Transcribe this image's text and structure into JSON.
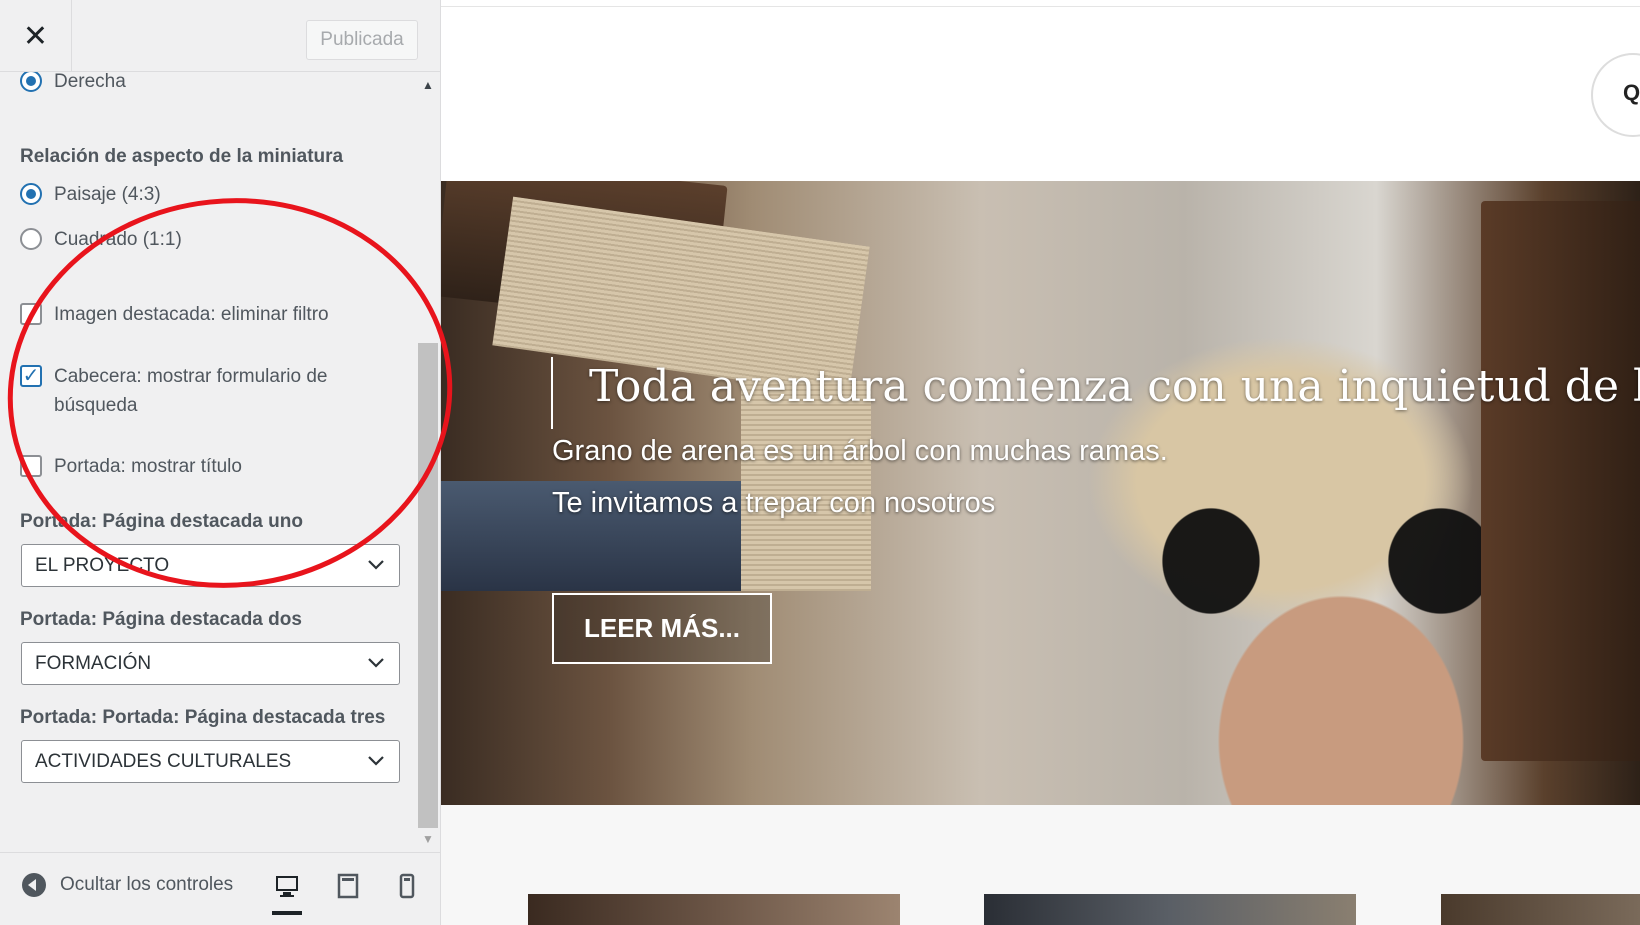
{
  "header": {
    "close_icon": "close-icon",
    "publish_label": "Publicada"
  },
  "options": {
    "position_selected": "Derecha",
    "aspect_title": "Relación de aspecto de la miniatura",
    "aspect_landscape": "Paisaje (4:3)",
    "aspect_square": "Cuadrado (1:1)",
    "featured_image_filter": "Imagen destacada: eliminar filtro",
    "header_search_form": "Cabecera: mostrar formulario de búsqueda",
    "home_show_title": "Portada: mostrar título",
    "featured_one_label": "Portada: Página destacada uno",
    "featured_one_value": "EL PROYECTO",
    "featured_two_label": "Portada: Página destacada dos",
    "featured_two_value": "FORMACIÓN",
    "featured_three_label": "Portada: Portada: Página destacada tres",
    "featured_three_value": "ACTIVIDADES CULTURALES",
    "checked": {
      "featured_image_filter": false,
      "header_search_form": true,
      "home_show_title": false
    },
    "selected_aspect": "Paisaje (4:3)"
  },
  "footer": {
    "hide_controls_label": "Ocultar los controles",
    "devices": [
      "desktop-icon",
      "tablet-icon",
      "mobile-icon"
    ],
    "active_device": "desktop"
  },
  "preview": {
    "search_glyph": "Q",
    "hero_title": "Toda aventura comienza con una inquietud de búsque",
    "hero_sub_1": "Grano de arena es un árbol con muchas ramas.",
    "hero_sub_2": "Te invitamos a trepar con nosotros",
    "hero_button": "LEER MÁS..."
  },
  "colors": {
    "accent": "#2271b1",
    "annotation": "#e8141c"
  }
}
